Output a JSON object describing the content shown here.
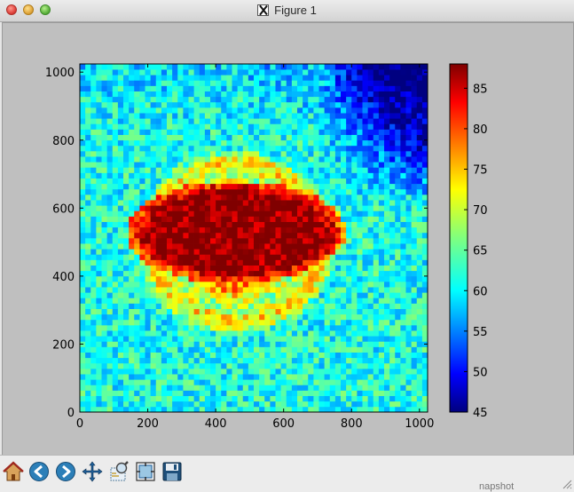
{
  "window": {
    "title": "Figure 1"
  },
  "colors": {
    "canvas_bg": "#bfbfbf",
    "colormap": "jet"
  },
  "toolbar": {
    "buttons": [
      {
        "name": "home-icon"
      },
      {
        "name": "back-arrow-icon"
      },
      {
        "name": "forward-arrow-icon"
      },
      {
        "name": "pan-icon"
      },
      {
        "name": "zoom-icon"
      },
      {
        "name": "subplots-icon"
      },
      {
        "name": "save-icon"
      }
    ]
  },
  "snapshot_label": "napshot",
  "chart_data": {
    "type": "heatmap",
    "title": "",
    "xlabel": "",
    "ylabel": "",
    "xlim": [
      0,
      1024
    ],
    "ylim": [
      0,
      1024
    ],
    "x_ticks": [
      "0",
      "200",
      "400",
      "600",
      "800",
      "1000"
    ],
    "y_ticks": [
      "0",
      "200",
      "400",
      "600",
      "800",
      "1000"
    ],
    "colorbar": {
      "colormap": "jet",
      "range": [
        45,
        88
      ],
      "ticks": [
        "45",
        "50",
        "55",
        "60",
        "65",
        "70",
        "75",
        "80",
        "85"
      ]
    },
    "features": {
      "hot_core": {
        "center": [
          460,
          530
        ],
        "radius_x": 300,
        "radius_y": 140,
        "value": 88
      },
      "warm_ring": {
        "center": [
          460,
          500
        ],
        "radius_x": 330,
        "radius_y": 300,
        "value": 75
      },
      "background_level": 62,
      "cold_corner": "top-right"
    }
  }
}
